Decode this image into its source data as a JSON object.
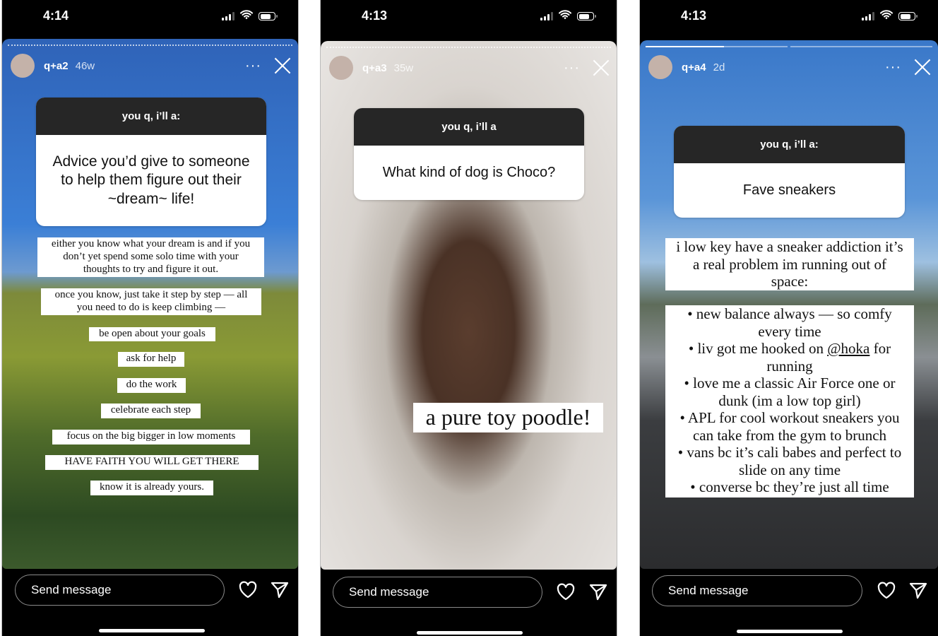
{
  "colors": {
    "question_header": "#262626",
    "text_box": "#ffffff",
    "background": "#000000"
  },
  "icons": {
    "more": "more-horizontal-icon",
    "close": "close-x-icon",
    "like": "heart-icon",
    "share": "paper-plane-icon",
    "signal": "cellular-signal-icon",
    "wifi": "wifi-icon",
    "battery": "battery-icon"
  },
  "stories": [
    {
      "status_time": "4:14",
      "username": "q+a2",
      "age": "46w",
      "progress": {
        "style": "dotted",
        "segments": 1,
        "current_fill": 0
      },
      "question_header": "you q, i’ll a:",
      "question": "Advice you’d give to someone to help them figure out their ~dream~ life!",
      "answers": [
        "either you know what your dream is and if you\ndon’t yet spend some solo time with your\nthoughts to try and figure it out.",
        "once you know, just take it step by step — all\nyou need to do is keep climbing —",
        "be open about your goals",
        "ask for help",
        "do the work",
        "celebrate each step",
        "focus on the big bigger in low moments",
        "HAVE FAITH YOU WILL GET THERE",
        "know it is already yours."
      ],
      "message_placeholder": "Send message"
    },
    {
      "status_time": "4:13",
      "username": "q+a3",
      "age": "35w",
      "progress": {
        "style": "dotted",
        "segments": 1,
        "current_fill": 0
      },
      "question_header": "you q, i’ll a",
      "question": "What kind of dog is Choco?",
      "answers": [
        "a pure toy poodle!"
      ],
      "message_placeholder": "Send message"
    },
    {
      "status_time": "4:13",
      "username": "q+a4",
      "age": "2d",
      "progress": {
        "style": "bars",
        "segments": 2,
        "current_fill": 0.55
      },
      "question_header": "you q, i’ll a:",
      "question": "Fave sneakers",
      "answers": [
        "i low key have a sneaker addiction it’s\na real problem im running out of\nspace:",
        "• new balance always — so comfy\nevery time\n• liv got me hooked on @hoka for\nrunning\n• love me a classic Air Force one or\ndunk (im a low top girl)\n• APL for cool workout sneakers you\ncan take from the gym to brunch\n• vans bc it’s cali babes and perfect to\nslide on any time\n• converse bc they’re just all time"
      ],
      "message_placeholder": "Send message"
    }
  ]
}
